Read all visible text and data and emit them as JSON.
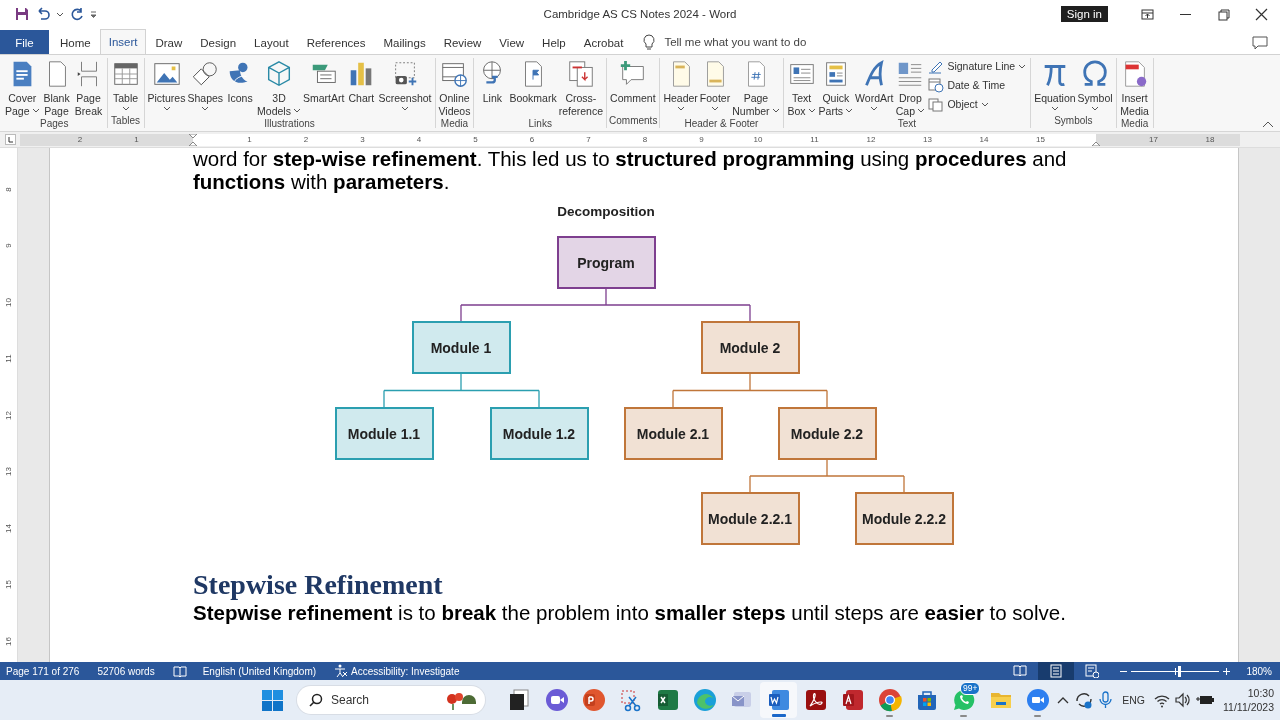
{
  "window": {
    "title": "Cambridge AS CS Notes 2024  -  Word",
    "sign_in": "Sign in"
  },
  "tabs": [
    {
      "label": "File",
      "kind": "file",
      "selected": false
    },
    {
      "label": "Home",
      "kind": "tab",
      "selected": false
    },
    {
      "label": "Insert",
      "kind": "tab",
      "selected": true
    },
    {
      "label": "Draw",
      "kind": "tab",
      "selected": false
    },
    {
      "label": "Design",
      "kind": "tab",
      "selected": false
    },
    {
      "label": "Layout",
      "kind": "tab",
      "selected": false
    },
    {
      "label": "References",
      "kind": "tab",
      "selected": false
    },
    {
      "label": "Mailings",
      "kind": "tab",
      "selected": false
    },
    {
      "label": "Review",
      "kind": "tab",
      "selected": false
    },
    {
      "label": "View",
      "kind": "tab",
      "selected": false
    },
    {
      "label": "Help",
      "kind": "tab",
      "selected": false
    },
    {
      "label": "Acrobat",
      "kind": "tab",
      "selected": false
    }
  ],
  "tell_me": {
    "placeholder": "Tell me what you want to do"
  },
  "ribbon": {
    "groups": [
      {
        "label": "Pages",
        "items": [
          {
            "lines": [
              "Cover",
              "Page"
            ],
            "dropdown": true
          },
          {
            "lines": [
              "Blank",
              "Page"
            ],
            "dropdown": false
          },
          {
            "lines": [
              "Page",
              "Break"
            ],
            "dropdown": false
          }
        ]
      },
      {
        "label": "Tables",
        "items": [
          {
            "lines": [
              "Table"
            ],
            "dropdown": true
          }
        ]
      },
      {
        "label": "Illustrations",
        "items": [
          {
            "lines": [
              "Pictures"
            ],
            "dropdown": true
          },
          {
            "lines": [
              "Shapes"
            ],
            "dropdown": true
          },
          {
            "lines": [
              "Icons"
            ],
            "dropdown": false
          },
          {
            "lines": [
              "3D",
              "Models"
            ],
            "dropdown": true
          },
          {
            "lines": [
              "SmartArt"
            ],
            "dropdown": false
          },
          {
            "lines": [
              "Chart"
            ],
            "dropdown": false
          },
          {
            "lines": [
              "Screenshot"
            ],
            "dropdown": true
          }
        ]
      },
      {
        "label": "Media",
        "items": [
          {
            "lines": [
              "Online",
              "Videos"
            ],
            "dropdown": false
          }
        ]
      },
      {
        "label": "Links",
        "items": [
          {
            "lines": [
              "Link"
            ],
            "dropdown": false
          },
          {
            "lines": [
              "Bookmark"
            ],
            "dropdown": false
          },
          {
            "lines": [
              "Cross-",
              "reference"
            ],
            "dropdown": false
          }
        ]
      },
      {
        "label": "Comments",
        "items": [
          {
            "lines": [
              "Comment"
            ],
            "dropdown": false
          }
        ]
      },
      {
        "label": "Header & Footer",
        "items": [
          {
            "lines": [
              "Header"
            ],
            "dropdown": true
          },
          {
            "lines": [
              "Footer"
            ],
            "dropdown": true
          },
          {
            "lines": [
              "Page",
              "Number"
            ],
            "dropdown": true
          }
        ]
      },
      {
        "label": "Text",
        "items": [
          {
            "lines": [
              "Text",
              "Box"
            ],
            "dropdown": true
          },
          {
            "lines": [
              "Quick",
              "Parts"
            ],
            "dropdown": true
          },
          {
            "lines": [
              "WordArt"
            ],
            "dropdown": true
          },
          {
            "lines": [
              "Drop",
              "Cap"
            ],
            "dropdown": true
          }
        ],
        "small_items": [
          {
            "label": "Signature Line",
            "dropdown": true
          },
          {
            "label": "Date & Time",
            "dropdown": false
          },
          {
            "label": "Object",
            "dropdown": true
          }
        ]
      },
      {
        "label": "Symbols",
        "items": [
          {
            "lines": [
              "Equation"
            ],
            "dropdown": true
          },
          {
            "lines": [
              "Symbol"
            ],
            "dropdown": true
          }
        ]
      },
      {
        "label": "Media",
        "items": [
          {
            "lines": [
              "Insert",
              "Media"
            ],
            "dropdown": false
          }
        ]
      }
    ]
  },
  "ruler": {
    "labels": [
      "2",
      "1",
      "1",
      "2",
      "3",
      "4",
      "5",
      "6",
      "7",
      "8",
      "9",
      "10",
      "11",
      "12",
      "13",
      "14",
      "15",
      "17",
      "18"
    ]
  },
  "vertical_ruler": {
    "labels": [
      "8",
      "9",
      "10",
      "11",
      "12",
      "13",
      "14",
      "15",
      "16"
    ]
  },
  "document": {
    "lines": [
      "word for **step-wise refinement**. This led us to **structured programming** using **procedures** and",
      "**functions** with **parameters**."
    ],
    "diagram": {
      "title": "Decomposition",
      "root": {
        "label": "Program",
        "color": "#7e3f8f",
        "children": [
          {
            "label": "Module 1",
            "color": "#2b9fb0",
            "children": [
              {
                "label": "Module 1.1",
                "color": "#2b9fb0"
              },
              {
                "label": "Module 1.2",
                "color": "#2b9fb0"
              }
            ]
          },
          {
            "label": "Module 2",
            "color": "#c0763a",
            "children": [
              {
                "label": "Module 2.1",
                "color": "#c0763a"
              },
              {
                "label": "Module 2.2",
                "color": "#c0763a",
                "children": [
                  {
                    "label": "Module 2.2.1",
                    "color": "#c0763a"
                  },
                  {
                    "label": "Module 2.2.2",
                    "color": "#c0763a"
                  }
                ]
              }
            ]
          }
        ]
      }
    },
    "heading": "Stepwise Refinement",
    "paragraph": "**Stepwise refinement** is to **break** the problem into **smaller steps** until steps are **easier** to solve."
  },
  "status_bar": {
    "page": "Page 171 of 276",
    "words": "52706 words",
    "language": "English (United Kingdom)",
    "accessibility": "Accessibility: Investigate",
    "views": [
      {
        "selected": false
      },
      {
        "selected": true
      },
      {
        "selected": false
      }
    ],
    "zoom": {
      "level": 0.54,
      "reading": "180%"
    }
  },
  "taskbar": {
    "search": {
      "placeholder": "Search"
    },
    "apps": [
      {
        "running": false,
        "active": false
      },
      {
        "running": false,
        "active": false
      },
      {
        "running": false,
        "active": false
      },
      {
        "running": false,
        "active": false
      },
      {
        "running": false,
        "active": false
      },
      {
        "running": false,
        "active": false
      },
      {
        "running": false,
        "active": false
      },
      {
        "running": true,
        "active": true
      },
      {
        "running": false,
        "active": false
      },
      {
        "running": false,
        "active": false
      },
      {
        "running": true,
        "active": false
      },
      {
        "running": false,
        "active": false
      },
      {
        "running": true,
        "active": false,
        "badge": "99+"
      },
      {
        "running": false,
        "active": false
      },
      {
        "running": true,
        "active": false
      }
    ],
    "language": "ENG",
    "time": "10:30",
    "date": "11/11/2023"
  }
}
